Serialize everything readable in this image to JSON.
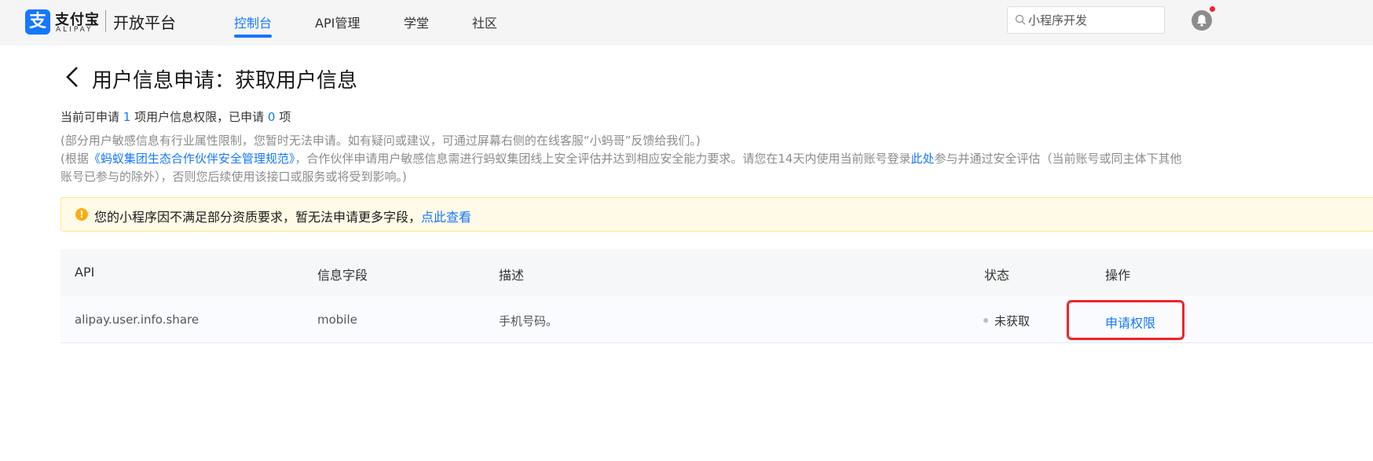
{
  "brand": {
    "logo_glyph": "支",
    "name_cn": "支付宝",
    "name_en": "ALIPAY",
    "platform": "开放平台",
    "color": "#1677ff"
  },
  "nav": {
    "items": [
      {
        "label": "控制台",
        "active": true
      },
      {
        "label": "API管理",
        "active": false
      },
      {
        "label": "学堂",
        "active": false
      },
      {
        "label": "社区",
        "active": false
      }
    ]
  },
  "search": {
    "placeholder": "小程序开发"
  },
  "icons": {
    "back": "chevron-left-icon",
    "search": "search-icon",
    "bell": "bell-icon",
    "warning": "exclamation-circle-icon"
  },
  "page": {
    "title": "用户信息申请：获取用户信息",
    "summary": {
      "prefix": "当前可申请 ",
      "available": "1",
      "middle": " 项用户信息权限，已申请 ",
      "applied": "0",
      "suffix": " 项"
    },
    "note1": "(部分用户敏感信息有行业属性限制，您暂时无法申请。如有疑问或建议，可通过屏幕右侧的在线客服“小蚂哥”反馈给我们。)",
    "note2": {
      "prefix": "(根据",
      "link1": "《蚂蚁集团生态合作伙伴安全管理规范》",
      "middle": "，合作伙伴申请用户敏感信息需进行蚂蚁集团线上安全评估并达到相应安全能力要求。请您在14天内使用当前账号登录",
      "link2": "此处",
      "suffix": "参与并通过安全评估（当前账号或同主体下其他",
      "line2": "账号已参与的除外），否则您后续使用该接口或服务或将受到影响。)"
    }
  },
  "banner": {
    "icon_glyph": "!",
    "text": "您的小程序因不满足部分资质要求，暂无法申请更多字段，",
    "link": "点此查看",
    "color": "#faad14"
  },
  "table": {
    "headers": [
      "API",
      "信息字段",
      "描述",
      "状态",
      "操作"
    ],
    "rows": [
      {
        "api": "alipay.user.info.share",
        "field": "mobile",
        "desc": "手机号码。",
        "status": "未获取",
        "action": "申请权限"
      }
    ]
  }
}
